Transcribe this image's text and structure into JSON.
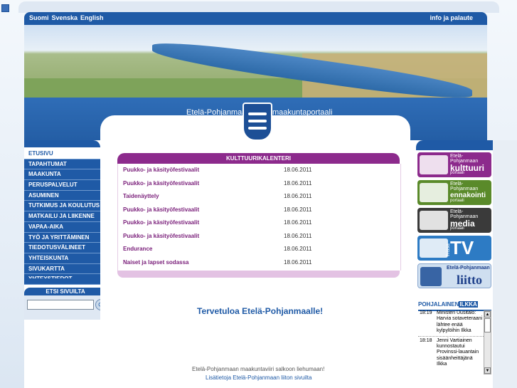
{
  "header": {
    "languages": [
      "Suomi",
      "Svenska",
      "English"
    ],
    "info_link": "info ja palaute"
  },
  "banner": {
    "left_text": "Etelä-Pohjanmaa",
    "right_text": "maakuntaportaali"
  },
  "nav": {
    "items": [
      "ETUSIVU",
      "TAPAHTUMAT",
      "MAAKUNTA",
      "PERUSPALVELUT",
      "ASUMINEN",
      "TUTKIMUS JA KOULUTUS",
      "MATKAILU JA LIIKENNE",
      "VAPAA-AIKA",
      "TYÖ JA YRITTÄMINEN",
      "TIEDOTUSVÄLINEET",
      "YHTEISKUNTA",
      "SIVUKARTTA",
      "YHTEYSTIEDOT"
    ],
    "active_index": 0
  },
  "search": {
    "heading": "ETSI SIVUILTA",
    "input_value": ""
  },
  "calendar": {
    "heading": "KULTTUURIKALENTERI",
    "rows": [
      {
        "title": "Puukko- ja käsityöfestivaalit",
        "date": "18.06.2011"
      },
      {
        "title": "Puukko- ja käsityöfestivaalit",
        "date": "18.06.2011"
      },
      {
        "title": "Taidenäyttely",
        "date": "18.06.2011"
      },
      {
        "title": "Puukko- ja käsityöfestivaalit",
        "date": "18.06.2011"
      },
      {
        "title": "Puukko- ja käsityöfestivaalit",
        "date": "18.06.2011"
      },
      {
        "title": "Puukko- ja käsityöfestivaalit",
        "date": "18.06.2011"
      },
      {
        "title": "Endurance",
        "date": "18.06.2011"
      },
      {
        "title": "Naiset ja lapset sodassa",
        "date": "18.06.2011"
      }
    ]
  },
  "main": {
    "welcome": "Tervetuloa Etelä-Pohjanmaalle!",
    "flag_text": "Etelä-Pohjanmaan maakuntaviiri salkoon liehumaan!",
    "flag_link": "Lisätietoja Etelä-Pohjanmaan liiton sivuilta"
  },
  "portals": [
    {
      "line1": "Etelä-",
      "line1b": "Pohjanmaan",
      "big": "kulttuuri",
      "small": "portaali",
      "color": "#8c2a8c"
    },
    {
      "line1": "Etelä-",
      "line1b": "Pohjanmaan",
      "big": "ennakointi",
      "small": "portaali",
      "color": "#5a8a2a"
    },
    {
      "line1": "Etelä-",
      "line1b": "Pohjanmaan",
      "big": "media",
      "small": "portaali",
      "color": "#3a3a3a"
    },
    {
      "big": "TV",
      "side": "Trissa",
      "color": "#2d7bc4"
    },
    {
      "line1": "Etelä-Pohjanmaan",
      "big": "liitto",
      "color": "#cfdff0"
    }
  ],
  "ilkka": {
    "brand_a": "POHJALAINEN",
    "brand_b": "ILKKA",
    "news": [
      {
        "time": "18:19",
        "text": "Ministeri Uusitalo: Harvia sotaveteraani lähtee enää kylpylöihin Ilkka"
      },
      {
        "time": "18:18",
        "text": "Jenni Vartiainen kunnostautui Provinssi-lauantain sisäänheittäjänä Ilkka"
      }
    ]
  },
  "colors": {
    "primary": "#1f5aa6",
    "culture": "#8c2a8c"
  }
}
